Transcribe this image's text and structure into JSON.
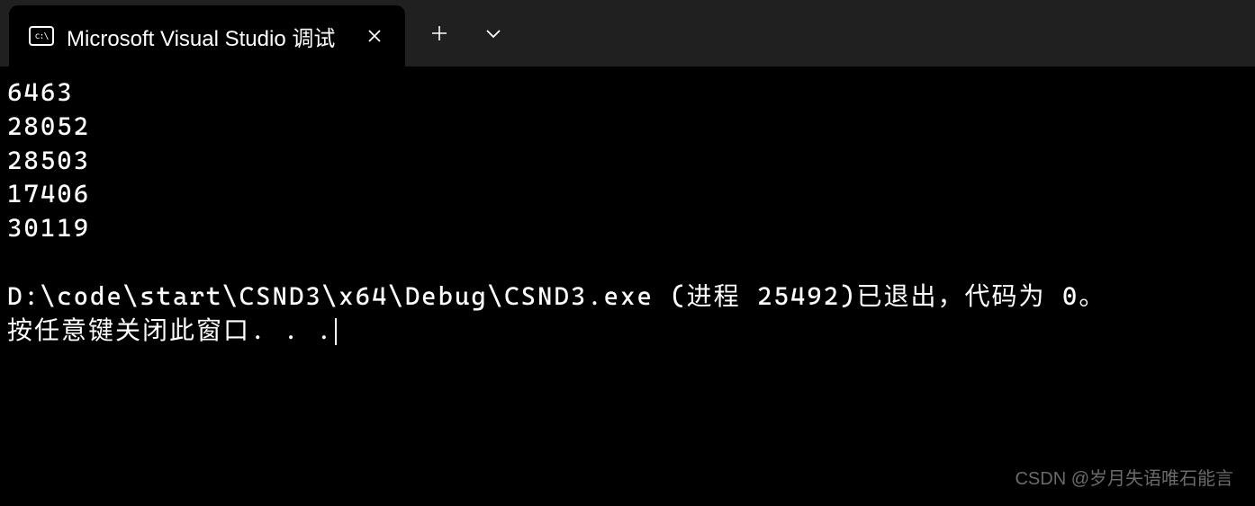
{
  "tab": {
    "title": "Microsoft Visual Studio 调试"
  },
  "output": {
    "lines": [
      "6463",
      "28052",
      "28503",
      "17406",
      "30119"
    ],
    "exit_message": "D:\\code\\start\\CSND3\\x64\\Debug\\CSND3.exe (进程 25492)已退出，代码为 0。",
    "close_prompt": "按任意键关闭此窗口. . ."
  },
  "watermark": "CSDN @岁月失语唯石能言"
}
